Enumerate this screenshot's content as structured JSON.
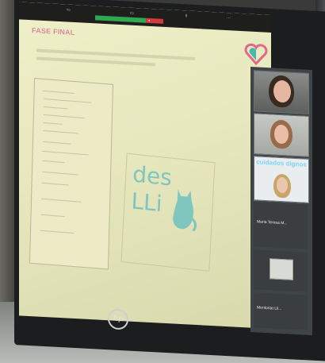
{
  "slide": {
    "title": "FASE FINAL",
    "logo_line1": "des",
    "logo_line2": "LLi"
  },
  "participants": {
    "banner": "cuidados dignos",
    "names": [
      "Maria Teresa M...",
      "Mentoriat Lli..."
    ]
  },
  "monitor_brand": "hp",
  "colors": {
    "slide_bg": "#ecebc4",
    "title": "#d98aa0",
    "logo": "#7fc6bf",
    "panel": "#3f4447",
    "banner": "#7fd3ff",
    "green_bar": "#2fa84f",
    "red_bar": "#d53a3a"
  }
}
